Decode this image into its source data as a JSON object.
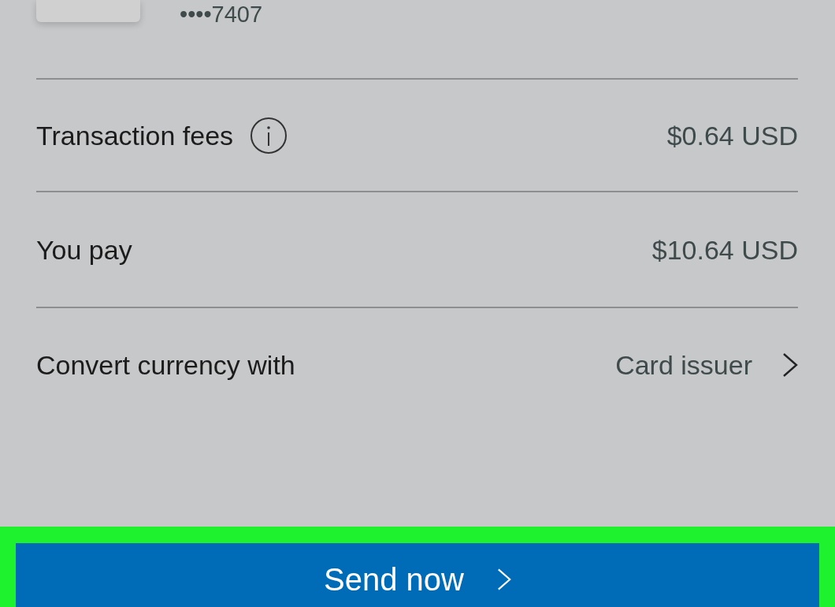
{
  "card": {
    "number": "••••7407"
  },
  "rows": [
    {
      "kind": "info",
      "label": "Transaction fees",
      "value": "$0.64 USD"
    },
    {
      "kind": "plain",
      "label": "You pay",
      "value": "$10.64 USD"
    },
    {
      "kind": "link",
      "label": "Convert currency with",
      "value": "Card issuer"
    }
  ],
  "send_button": {
    "label": "Send now",
    "highlighted": true
  }
}
